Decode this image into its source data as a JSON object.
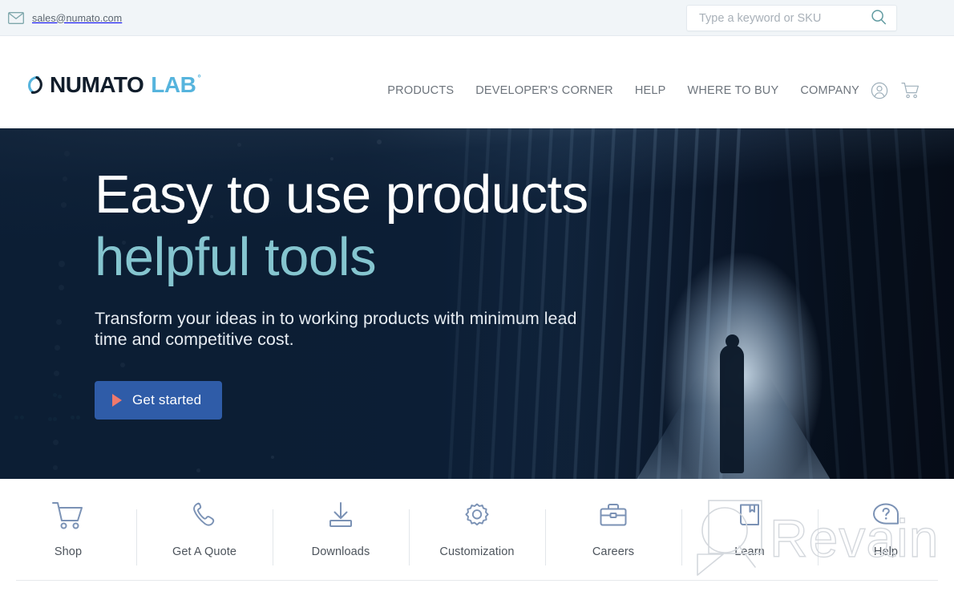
{
  "topbar": {
    "email": "sales@numato.com",
    "email_icon": "envelope-icon",
    "search": {
      "placeholder": "Type a keyword or SKU",
      "value": "",
      "icon": "search-icon"
    }
  },
  "header": {
    "logo": {
      "mark": "numato-swirl-icon",
      "name": "NUMATO",
      "suffix": "LAB",
      "registered": "°"
    },
    "nav": [
      {
        "label": "PRODUCTS"
      },
      {
        "label": "DEVELOPER'S CORNER"
      },
      {
        "label": "HELP"
      },
      {
        "label": "WHERE TO BUY"
      },
      {
        "label": "COMPANY"
      }
    ],
    "icons": [
      {
        "name": "account-icon"
      },
      {
        "name": "cart-icon"
      }
    ]
  },
  "hero": {
    "heading_line1": "Easy to use products",
    "heading_line2": "helpful tools",
    "subheading": "Transform your ideas in to working products with minimum lead time and competitive cost.",
    "cta_label": "Get started",
    "cta_icon": "play-triangle-icon",
    "colors": {
      "background": "#0e2038",
      "heading": "#ffffff",
      "heading_accent": "#85c5cf",
      "cta_background": "#2f5ca8",
      "cta_icon": "#f0796c"
    },
    "image_description": "data center corridor with server racks and a person standing in a lit doorway"
  },
  "quicklinks": [
    {
      "label": "Shop",
      "icon": "cart-icon"
    },
    {
      "label": "Get A Quote",
      "icon": "phone-icon"
    },
    {
      "label": "Downloads",
      "icon": "download-icon"
    },
    {
      "label": "Customization",
      "icon": "gear-icon"
    },
    {
      "label": "Careers",
      "icon": "briefcase-icon"
    },
    {
      "label": "Learn",
      "icon": "book-icon"
    },
    {
      "label": "Help",
      "icon": "question-bubble-icon"
    }
  ],
  "watermark": {
    "text": "Revain",
    "logo": "revain-magnifier-icon",
    "color": "#d4d8dd"
  }
}
